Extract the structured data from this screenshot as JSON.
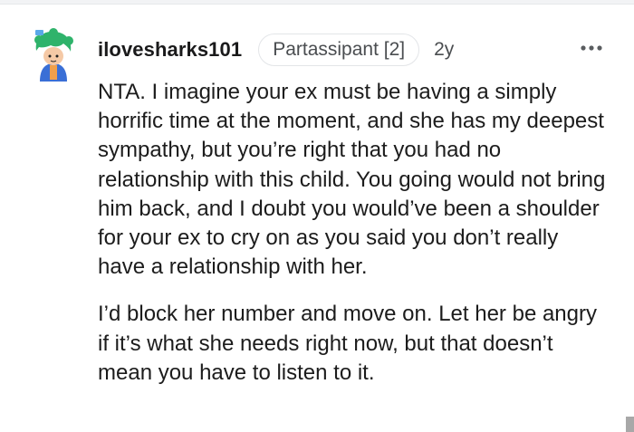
{
  "comment": {
    "username": "ilovesharks101",
    "flair": "Partassipant [2]",
    "age": "2y",
    "paragraphs": [
      "NTA. I imagine your ex must be having a simply horrific time at the moment, and she has my deepest sympathy, but you’re right that you had no relationship with this child. You going would not bring him back, and I doubt you would’ve been a shoulder for your ex to cry on as you said you don’t really have a relationship with her.",
      "I’d block her number and move on. Let her be angry if it’s what she needs right now, but that doesn’t mean you have to listen to it."
    ]
  },
  "icons": {
    "avatar": "avatar-icon",
    "more": "more-options-icon"
  },
  "colors": {
    "text": "#1c1c1c",
    "meta": "#4a4d50",
    "flair_border": "#e3e5e8",
    "avatar_hair": "#2fb36b",
    "avatar_body": "#3a6fd6"
  }
}
